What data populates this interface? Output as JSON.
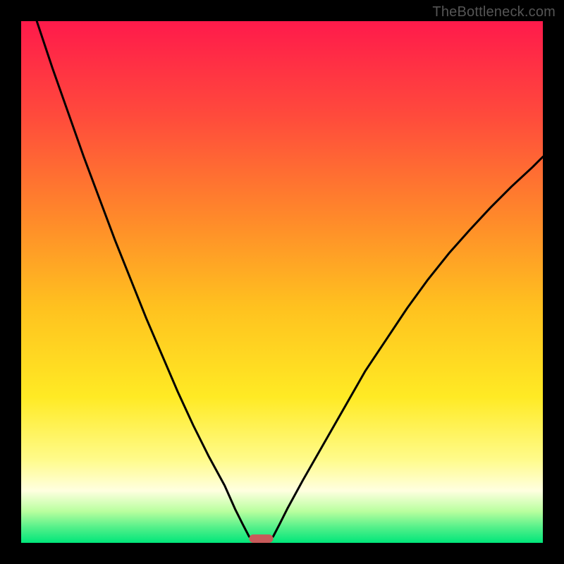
{
  "watermark": "TheBottleneck.com",
  "chart_data": {
    "type": "line",
    "title": "",
    "xlabel": "",
    "ylabel": "",
    "xlim": [
      0,
      100
    ],
    "ylim": [
      0,
      100
    ],
    "grid": false,
    "legend": false,
    "background": {
      "type": "vertical-gradient",
      "description": "Red at top through orange, yellow, pale-yellow, to green at bottom",
      "stops": [
        {
          "pos": 0.0,
          "color": "#ff1a4b"
        },
        {
          "pos": 0.18,
          "color": "#ff4a3c"
        },
        {
          "pos": 0.38,
          "color": "#ff8a2a"
        },
        {
          "pos": 0.55,
          "color": "#ffc21f"
        },
        {
          "pos": 0.72,
          "color": "#ffea24"
        },
        {
          "pos": 0.84,
          "color": "#fffb8a"
        },
        {
          "pos": 0.9,
          "color": "#ffffe0"
        },
        {
          "pos": 0.94,
          "color": "#b8ff9e"
        },
        {
          "pos": 0.97,
          "color": "#55f08a"
        },
        {
          "pos": 1.0,
          "color": "#00e67a"
        }
      ]
    },
    "series": [
      {
        "name": "left-curve",
        "color": "#000000",
        "x": [
          3,
          6,
          9,
          12,
          15,
          18,
          21,
          24,
          27,
          30,
          33,
          36,
          39,
          41,
          42.5,
          43.7
        ],
        "y": [
          100,
          91,
          82.5,
          74,
          66,
          58,
          50.5,
          43,
          36,
          29,
          22.5,
          16.5,
          11,
          6.5,
          3.5,
          1.2
        ]
      },
      {
        "name": "right-curve",
        "color": "#000000",
        "x": [
          48.3,
          49.5,
          51,
          54,
          58,
          62,
          66,
          70,
          74,
          78,
          82,
          86,
          90,
          94,
          98,
          100
        ],
        "y": [
          1.2,
          3.5,
          6.5,
          12,
          19,
          26,
          33,
          39,
          45,
          50.5,
          55.5,
          60,
          64.3,
          68.3,
          72,
          74
        ]
      }
    ],
    "marker": {
      "name": "minimum-pill",
      "shape": "rounded-rect",
      "color": "#c85a5a",
      "x_center": 46,
      "y": 0.8,
      "width": 4.6,
      "height": 1.6
    }
  }
}
